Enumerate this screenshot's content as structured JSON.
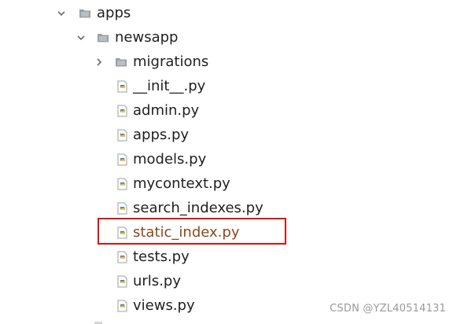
{
  "tree": {
    "apps": {
      "label": "apps",
      "expanded": true,
      "icon": "folder-icon"
    },
    "newsapp": {
      "label": "newsapp",
      "expanded": true,
      "icon": "folder-icon"
    },
    "migrations": {
      "label": "migrations",
      "expanded": false,
      "icon": "folder-icon"
    },
    "files": [
      {
        "label": "__init__.py",
        "icon": "python-file-icon"
      },
      {
        "label": "admin.py",
        "icon": "python-file-icon"
      },
      {
        "label": "apps.py",
        "icon": "python-file-icon"
      },
      {
        "label": "models.py",
        "icon": "python-file-icon"
      },
      {
        "label": "mycontext.py",
        "icon": "python-file-icon"
      },
      {
        "label": "search_indexes.py",
        "icon": "python-file-icon"
      },
      {
        "label": "static_index.py",
        "icon": "python-file-icon",
        "status": "modified",
        "highlighted": true
      },
      {
        "label": "tests.py",
        "icon": "python-file-icon"
      },
      {
        "label": "urls.py",
        "icon": "python-file-icon"
      },
      {
        "label": "views.py",
        "icon": "python-file-icon"
      }
    ]
  },
  "colors": {
    "text": "#1f1f1f",
    "modified_text": "#8a4a1e",
    "highlight_border": "#e01010",
    "folder": "#9aa0a6",
    "python_blue": "#3b78b5",
    "python_yellow": "#f2c230"
  },
  "watermark": "CSDN @YZL40514131"
}
